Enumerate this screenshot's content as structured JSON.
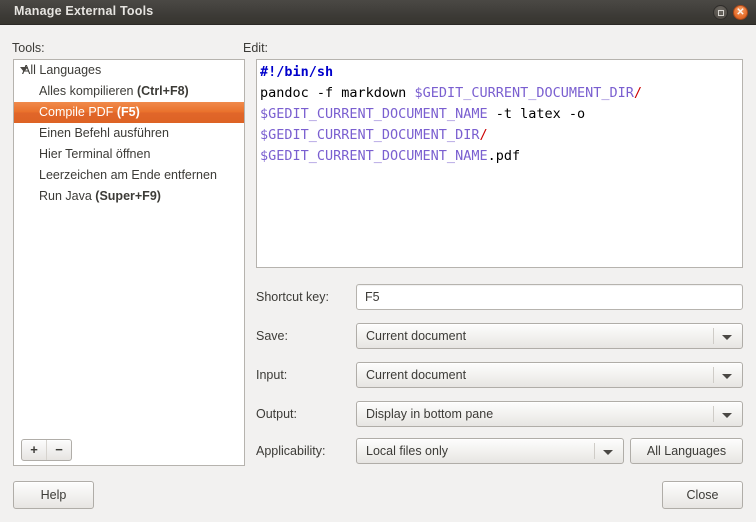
{
  "window": {
    "title": "Manage External Tools",
    "maximize_icon": "maximize-icon",
    "close_icon": "close-icon",
    "close_glyph": "✕"
  },
  "tools_pane": {
    "label": "Tools:",
    "group": {
      "label": "All Languages",
      "expanded": true
    },
    "items": [
      {
        "name": "Alles kompilieren",
        "accel": "(Ctrl+F8)",
        "selected": false
      },
      {
        "name": "Compile PDF",
        "accel": "(F5)",
        "selected": true
      },
      {
        "name": "Einen Befehl ausführen",
        "accel": "",
        "selected": false
      },
      {
        "name": "Hier Terminal öffnen",
        "accel": "",
        "selected": false
      },
      {
        "name": "Leerzeichen am Ende entfernen",
        "accel": "",
        "selected": false
      },
      {
        "name": "Run Java",
        "accel": "(Super+F9)",
        "selected": false
      }
    ],
    "add_label": "+",
    "remove_label": "−",
    "selection_color": "#e8702d"
  },
  "edit_pane": {
    "label": "Edit:",
    "script_lines": [
      {
        "segments": [
          {
            "text": "#!/bin/sh",
            "type": "shebang"
          }
        ]
      },
      {
        "segments": [
          {
            "text": "pandoc -f markdown ",
            "type": "plain"
          },
          {
            "text": "$GEDIT_CURRENT_DOCUMENT_DIR",
            "type": "var"
          },
          {
            "text": "/",
            "type": "slash"
          }
        ]
      },
      {
        "segments": [
          {
            "text": "$GEDIT_CURRENT_DOCUMENT_NAME",
            "type": "var"
          },
          {
            "text": " -t latex -o",
            "type": "plain"
          }
        ]
      },
      {
        "segments": [
          {
            "text": "$GEDIT_CURRENT_DOCUMENT_DIR",
            "type": "var"
          },
          {
            "text": "/",
            "type": "slash"
          }
        ]
      },
      {
        "segments": [
          {
            "text": "$GEDIT_CURRENT_DOCUMENT_NAME",
            "type": "var"
          },
          {
            "text": ".pdf",
            "type": "plain"
          }
        ]
      }
    ],
    "script_plain": "#!/bin/sh\npandoc -f markdown $GEDIT_CURRENT_DOCUMENT_DIR/$GEDIT_CURRENT_DOCUMENT_NAME -t latex -o $GEDIT_CURRENT_DOCUMENT_DIR/$GEDIT_CURRENT_DOCUMENT_NAME.pdf",
    "colors": {
      "shebang": "#0000cc",
      "variable": "#7a5fd0",
      "slash": "#cc0000",
      "plain": "#000000"
    }
  },
  "form": {
    "shortcut": {
      "label": "Shortcut key:",
      "value": "F5",
      "placeholder": ""
    },
    "save": {
      "label": "Save:",
      "value": "Current document"
    },
    "input": {
      "label": "Input:",
      "value": "Current document"
    },
    "output": {
      "label": "Output:",
      "value": "Display in bottom pane"
    },
    "applicability": {
      "label": "Applicability:",
      "value": "Local files only",
      "languages_button": "All Languages"
    }
  },
  "footer": {
    "help_label": "Help",
    "close_label": "Close"
  }
}
